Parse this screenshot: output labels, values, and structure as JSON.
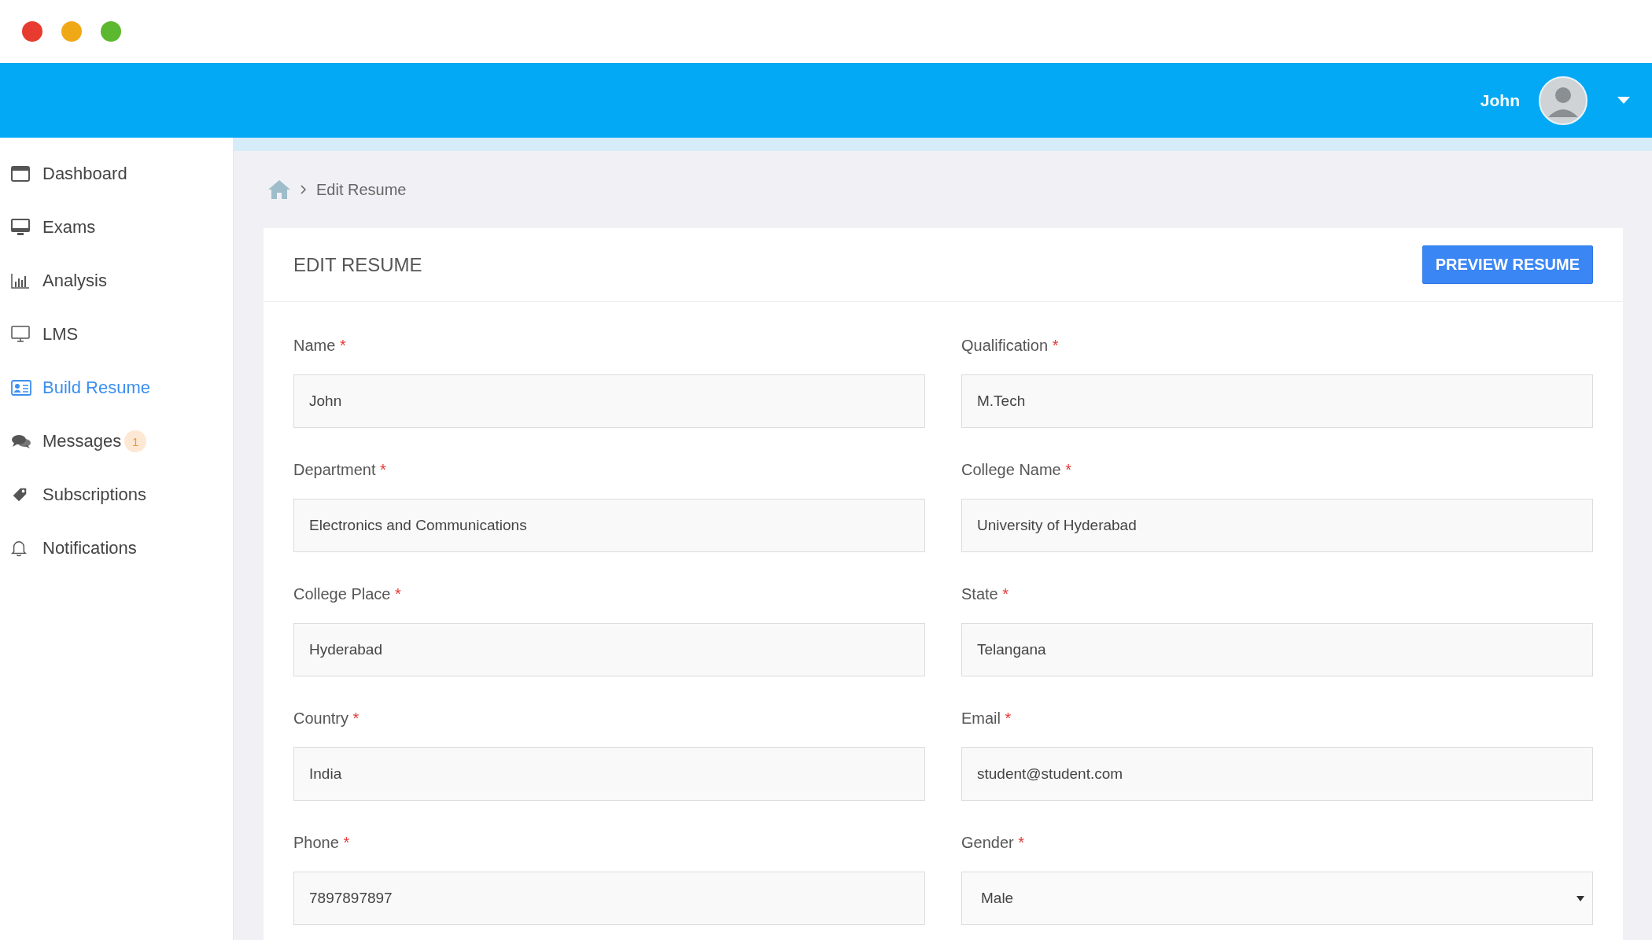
{
  "header": {
    "user_name": "John"
  },
  "sidebar": {
    "items": [
      {
        "label": "Dashboard",
        "selected": false
      },
      {
        "label": "Exams",
        "selected": false
      },
      {
        "label": "Analysis",
        "selected": false
      },
      {
        "label": "LMS",
        "selected": false
      },
      {
        "label": "Build Resume",
        "selected": true
      },
      {
        "label": "Messages",
        "selected": false,
        "badge": "1"
      },
      {
        "label": "Subscriptions",
        "selected": false
      },
      {
        "label": "Notifications",
        "selected": false
      }
    ]
  },
  "breadcrumb": {
    "current": "Edit Resume"
  },
  "card": {
    "title": "EDIT RESUME",
    "action_button": "PREVIEW RESUME",
    "fields": [
      {
        "label": "Name",
        "required_mark": "*",
        "kind": "text",
        "value": "John"
      },
      {
        "label": "Qualification",
        "required_mark": "*",
        "kind": "text",
        "value": "M.Tech"
      },
      {
        "label": "Department",
        "required_mark": "*",
        "kind": "text",
        "value": "Electronics and Communications"
      },
      {
        "label": "College Name",
        "required_mark": "*",
        "kind": "text",
        "value": "University of Hyderabad"
      },
      {
        "label": "College Place",
        "required_mark": "*",
        "kind": "text",
        "value": "Hyderabad"
      },
      {
        "label": "State",
        "required_mark": "*",
        "kind": "text",
        "value": "Telangana"
      },
      {
        "label": "Country",
        "required_mark": "*",
        "kind": "text",
        "value": "India"
      },
      {
        "label": "Email",
        "required_mark": "*",
        "kind": "text",
        "value": "student@student.com"
      },
      {
        "label": "Phone",
        "required_mark": "*",
        "kind": "text",
        "value": "7897897897"
      },
      {
        "label": "Gender",
        "required_mark": "*",
        "kind": "select",
        "value": "Male"
      }
    ]
  }
}
